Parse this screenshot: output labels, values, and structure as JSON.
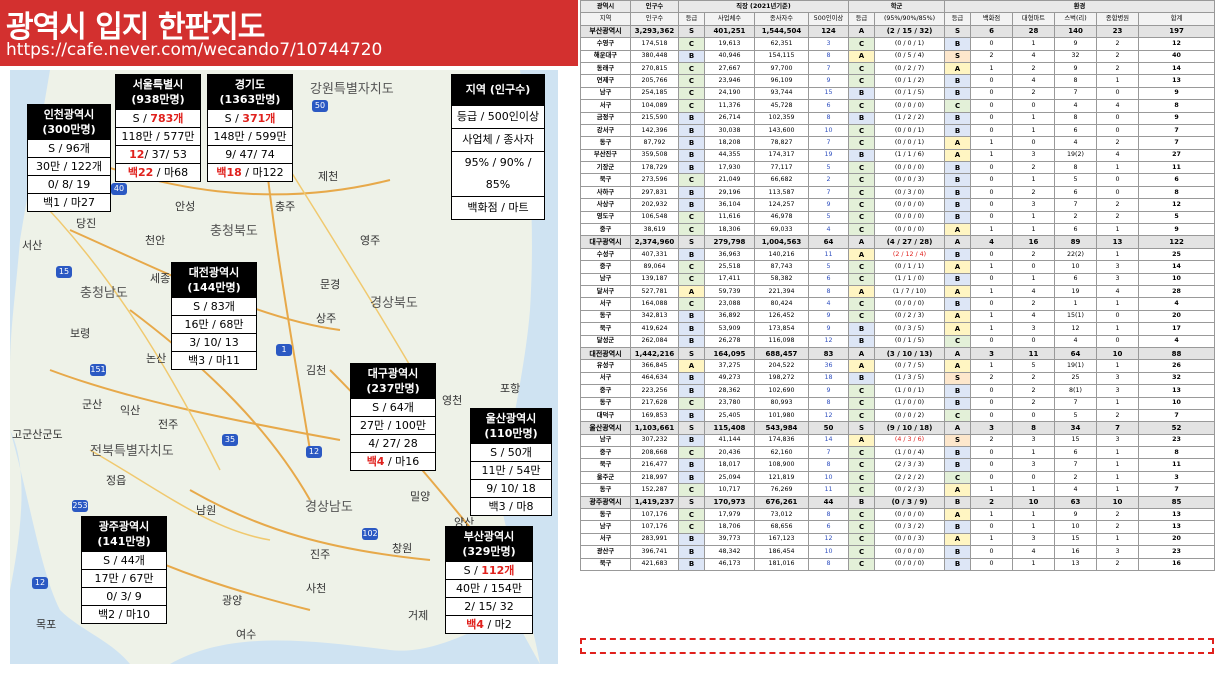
{
  "header": {
    "title": "광역시 입지 한판지도",
    "url": "https://cafe.never.com/wecando7/10744720"
  },
  "colors": {
    "red": "#e0211d",
    "header": "#d3302f"
  },
  "map": {
    "regions": [
      "강원특별자치도",
      "충청북도",
      "충청남도",
      "경상북도",
      "전북특별자치도",
      "경상남도"
    ],
    "places": [
      "안성",
      "충주",
      "제천",
      "당진",
      "서산",
      "천안",
      "영주",
      "세종",
      "문경",
      "보령",
      "논산",
      "상주",
      "김천",
      "군산",
      "익산",
      "전주",
      "영천",
      "포항",
      "정읍",
      "밀양",
      "남원",
      "양산",
      "고군산군도",
      "진주",
      "창원",
      "사천",
      "거제",
      "목포",
      "여수",
      "광양",
      "광주",
      "대구",
      "부산"
    ],
    "highways": [
      "50",
      "15",
      "1",
      "151",
      "35",
      "12",
      "253",
      "102",
      "12",
      "40"
    ]
  },
  "boxes": {
    "incheon": {
      "name": "인천광역시",
      "pop": "(300만명)",
      "r1a": "S / ",
      "r1b": "96개",
      "r2": "30만 / 122개",
      "r3": "0/ 8/ 19",
      "r4": "백1 / 마27"
    },
    "seoul": {
      "name": "서울특별시",
      "pop": "(938만명)",
      "r1a": "S / ",
      "r1b": "783개",
      "r2": "118만 / 577만",
      "r3a": "12",
      "r3b": "/ 37/ 53",
      "r4a": "백22",
      "r4b": " / 마68"
    },
    "gyeonggi": {
      "name": "경기도",
      "pop": "(1363만명)",
      "r1a": "S / ",
      "r1b": "371개",
      "r2": "148만 / 599만",
      "r3": "9/ 47/ 74",
      "r4a": "백18",
      "r4b": " / 마122"
    },
    "legend": {
      "name": "지역  (인구수)",
      "r1": "등급 / 500인이상",
      "r2": "사업체 / 종사자",
      "r3": "95% / 90% / 85%",
      "r4": "백화점 / 마트"
    },
    "daejeon": {
      "name": "대전광역시",
      "pop": "(144만명)",
      "r1": "S / 83개",
      "r2": "16만 / 68만",
      "r3": "3/ 10/ 13",
      "r4": "백3 / 마11"
    },
    "daegu": {
      "name": "대구광역시",
      "pop": "(237만명)",
      "r1": "S / 64개",
      "r2": "27만 / 100만",
      "r3": "4/ 27/ 28",
      "r4a": "백4",
      "r4b": " / 마16"
    },
    "ulsan": {
      "name": "울산광역시",
      "pop": "(110만명)",
      "r1": "S / 50개",
      "r2": "11만 / 54만",
      "r3": "9/ 10/ 18",
      "r4": "백3 / 마8"
    },
    "gwangju": {
      "name": "광주광역시",
      "pop": "(141만명)",
      "r1": "S / 44개",
      "r2": "17만 / 67만",
      "r3": "0/ 3/ 9",
      "r4": "백2 / 마10"
    },
    "busan": {
      "name": "부산광역시",
      "pop": "(329만명)",
      "r1a": "S / ",
      "r1b": "112개",
      "r2": "40만 / 154만",
      "r3": "2/ 15/ 32",
      "r4a": "백4",
      "r4b": " / 마2"
    }
  },
  "table": {
    "h1": {
      "metro": "광역시",
      "pop": "인구수",
      "jobs": "직장 (2021년기준)",
      "school": "학군",
      "env": "환경"
    },
    "h2": [
      "지역",
      "인구수",
      "등급",
      "사업체수",
      "종사자수",
      "500인이상",
      "등급",
      "(95%/90%/85%)",
      "등급",
      "백화점",
      "대형마트",
      "스벅(리)",
      "종합병원",
      "합계"
    ],
    "rows": [
      {
        "m": 1,
        "c": [
          "부산광역시",
          "3,293,362",
          "S",
          "401,251",
          "1,544,504",
          "124",
          "A",
          "(2 / 15 / 32)",
          "S",
          "6",
          "28",
          "140",
          "23",
          "197"
        ]
      },
      {
        "c": [
          "수영구",
          "174,518",
          "C",
          "19,613",
          "62,351",
          "3",
          "C",
          "(0 / 0 / 1)",
          "B",
          "0",
          "1",
          "9",
          "2",
          "12"
        ]
      },
      {
        "c": [
          "해운대구",
          "380,448",
          "B",
          "40,946",
          "154,115",
          "8",
          "A",
          "(0 / 5 / 4)",
          "S",
          "2",
          "4",
          "32",
          "2",
          "40"
        ]
      },
      {
        "c": [
          "동래구",
          "270,815",
          "C",
          "27,667",
          "97,700",
          "7",
          "C",
          "(0 / 2 / 7)",
          "A",
          "1",
          "2",
          "9",
          "2",
          "14"
        ]
      },
      {
        "c": [
          "연제구",
          "205,766",
          "C",
          "23,946",
          "96,109",
          "9",
          "C",
          "(0 / 1 / 2)",
          "B",
          "0",
          "4",
          "8",
          "1",
          "13"
        ]
      },
      {
        "c": [
          "남구",
          "254,185",
          "C",
          "24,190",
          "93,744",
          "15",
          "B",
          "(0 / 1 / 5)",
          "B",
          "0",
          "2",
          "7",
          "0",
          "9"
        ]
      },
      {
        "c": [
          "서구",
          "104,089",
          "C",
          "11,376",
          "45,728",
          "6",
          "C",
          "(0 / 0 / 0)",
          "C",
          "0",
          "0",
          "4",
          "4",
          "8"
        ]
      },
      {
        "c": [
          "금정구",
          "215,590",
          "B",
          "26,714",
          "102,359",
          "8",
          "B",
          "(1 / 2 / 2)",
          "B",
          "0",
          "1",
          "8",
          "0",
          "9"
        ]
      },
      {
        "c": [
          "강서구",
          "142,396",
          "B",
          "30,038",
          "143,600",
          "10",
          "C",
          "(0 / 0 / 1)",
          "B",
          "0",
          "1",
          "6",
          "0",
          "7"
        ]
      },
      {
        "c": [
          "동구",
          "87,792",
          "B",
          "18,208",
          "78,827",
          "7",
          "C",
          "(0 / 0 / 1)",
          "A",
          "1",
          "0",
          "4",
          "2",
          "7"
        ]
      },
      {
        "c": [
          "부산진구",
          "359,508",
          "B",
          "44,355",
          "174,317",
          "19",
          "B",
          "(1 / 1 / 6)",
          "A",
          "1",
          "3",
          "19(2)",
          "4",
          "27"
        ]
      },
      {
        "c": [
          "기장군",
          "178,729",
          "B",
          "17,930",
          "77,117",
          "5",
          "C",
          "(0 / 0 / 0)",
          "B",
          "0",
          "2",
          "8",
          "1",
          "11"
        ]
      },
      {
        "c": [
          "북구",
          "273,596",
          "C",
          "21,049",
          "66,682",
          "2",
          "C",
          "(0 / 0 / 3)",
          "B",
          "0",
          "1",
          "5",
          "0",
          "6"
        ]
      },
      {
        "c": [
          "사하구",
          "297,831",
          "B",
          "29,196",
          "113,587",
          "7",
          "C",
          "(0 / 3 / 0)",
          "B",
          "0",
          "2",
          "6",
          "0",
          "8"
        ]
      },
      {
        "c": [
          "사상구",
          "202,932",
          "B",
          "36,104",
          "124,257",
          "9",
          "C",
          "(0 / 0 / 0)",
          "B",
          "0",
          "3",
          "7",
          "2",
          "12"
        ]
      },
      {
        "c": [
          "영도구",
          "106,548",
          "C",
          "11,616",
          "46,978",
          "5",
          "C",
          "(0 / 0 / 0)",
          "B",
          "0",
          "1",
          "2",
          "2",
          "5"
        ]
      },
      {
        "c": [
          "중구",
          "38,619",
          "C",
          "18,306",
          "69,033",
          "4",
          "C",
          "(0 / 0 / 0)",
          "A",
          "1",
          "1",
          "6",
          "1",
          "9"
        ]
      },
      {
        "m": 1,
        "c": [
          "대구광역시",
          "2,374,960",
          "S",
          "279,798",
          "1,004,563",
          "64",
          "A",
          "(4 / 27 / 28)",
          "A",
          "4",
          "16",
          "89",
          "13",
          "122"
        ]
      },
      {
        "c": [
          "수성구",
          "407,331",
          "B",
          "36,963",
          "140,216",
          "11",
          "A",
          "(2 / 12 / 4)",
          "B",
          "0",
          "2",
          "22(2)",
          "1",
          "25"
        ]
      },
      {
        "c": [
          "중구",
          "89,064",
          "C",
          "25,518",
          "87,743",
          "5",
          "C",
          "(0 / 1 / 1)",
          "A",
          "1",
          "0",
          "10",
          "3",
          "14"
        ]
      },
      {
        "c": [
          "남구",
          "139,187",
          "C",
          "17,411",
          "58,382",
          "6",
          "C",
          "(1 / 1 / 0)",
          "B",
          "0",
          "1",
          "6",
          "3",
          "10"
        ]
      },
      {
        "c": [
          "달서구",
          "527,781",
          "A",
          "59,739",
          "221,394",
          "8",
          "A",
          "(1 / 7 / 10)",
          "A",
          "1",
          "4",
          "19",
          "4",
          "28"
        ]
      },
      {
        "c": [
          "서구",
          "164,088",
          "C",
          "23,088",
          "80,424",
          "4",
          "C",
          "(0 / 0 / 0)",
          "B",
          "0",
          "2",
          "1",
          "1",
          "4"
        ]
      },
      {
        "c": [
          "동구",
          "342,813",
          "B",
          "36,892",
          "126,452",
          "9",
          "C",
          "(0 / 2 / 3)",
          "A",
          "1",
          "4",
          "15(1)",
          "0",
          "20"
        ]
      },
      {
        "c": [
          "북구",
          "419,624",
          "B",
          "53,909",
          "173,854",
          "9",
          "B",
          "(0 / 3 / 5)",
          "A",
          "1",
          "3",
          "12",
          "1",
          "17"
        ]
      },
      {
        "c": [
          "달성군",
          "262,084",
          "B",
          "26,278",
          "116,098",
          "12",
          "B",
          "(0 / 1 / 5)",
          "C",
          "0",
          "0",
          "4",
          "0",
          "4"
        ]
      },
      {
        "m": 1,
        "c": [
          "대전광역시",
          "1,442,216",
          "S",
          "164,095",
          "688,457",
          "83",
          "A",
          "(3 / 10 / 13)",
          "A",
          "3",
          "11",
          "64",
          "10",
          "88"
        ]
      },
      {
        "c": [
          "유성구",
          "366,845",
          "A",
          "37,275",
          "204,522",
          "36",
          "A",
          "(0 / 7 / 5)",
          "A",
          "1",
          "5",
          "19(1)",
          "1",
          "26"
        ]
      },
      {
        "c": [
          "서구",
          "464,634",
          "B",
          "49,273",
          "198,272",
          "18",
          "B",
          "(1 / 3 / 5)",
          "S",
          "2",
          "2",
          "25",
          "3",
          "32"
        ]
      },
      {
        "c": [
          "중구",
          "223,256",
          "B",
          "28,362",
          "102,690",
          "9",
          "C",
          "(1 / 0 / 1)",
          "B",
          "0",
          "2",
          "8(1)",
          "3",
          "13"
        ]
      },
      {
        "c": [
          "동구",
          "217,628",
          "C",
          "23,780",
          "80,993",
          "8",
          "C",
          "(1 / 0 / 0)",
          "B",
          "0",
          "2",
          "7",
          "1",
          "10"
        ]
      },
      {
        "c": [
          "대덕구",
          "169,853",
          "B",
          "25,405",
          "101,980",
          "12",
          "C",
          "(0 / 0 / 2)",
          "C",
          "0",
          "0",
          "5",
          "2",
          "7"
        ]
      },
      {
        "m": 1,
        "c": [
          "울산광역시",
          "1,103,661",
          "S",
          "115,408",
          "543,984",
          "50",
          "S",
          "(9 / 10 / 18)",
          "A",
          "3",
          "8",
          "34",
          "7",
          "52"
        ]
      },
      {
        "c": [
          "남구",
          "307,232",
          "B",
          "41,144",
          "174,836",
          "14",
          "A",
          "(4 / 3 / 6)",
          "S",
          "2",
          "3",
          "15",
          "3",
          "23"
        ]
      },
      {
        "c": [
          "중구",
          "208,668",
          "C",
          "20,436",
          "62,160",
          "7",
          "C",
          "(1 / 0 / 4)",
          "B",
          "0",
          "1",
          "6",
          "1",
          "8"
        ]
      },
      {
        "c": [
          "북구",
          "216,477",
          "B",
          "18,017",
          "108,900",
          "8",
          "C",
          "(2 / 3 / 3)",
          "B",
          "0",
          "3",
          "7",
          "1",
          "11"
        ]
      },
      {
        "c": [
          "울주군",
          "218,997",
          "B",
          "25,094",
          "121,819",
          "10",
          "C",
          "(2 / 2 / 2)",
          "C",
          "0",
          "0",
          "2",
          "1",
          "3"
        ]
      },
      {
        "c": [
          "동구",
          "152,287",
          "C",
          "10,717",
          "76,269",
          "11",
          "C",
          "(0 / 2 / 3)",
          "A",
          "1",
          "1",
          "4",
          "1",
          "7"
        ]
      },
      {
        "m": 1,
        "c": [
          "광주광역시",
          "1,419,237",
          "S",
          "170,973",
          "676,261",
          "44",
          "B",
          "(0 / 3 / 9)",
          "B",
          "2",
          "10",
          "63",
          "10",
          "85"
        ]
      },
      {
        "c": [
          "동구",
          "107,176",
          "C",
          "17,979",
          "73,012",
          "8",
          "C",
          "(0 / 0 / 0)",
          "A",
          "1",
          "1",
          "9",
          "2",
          "13"
        ]
      },
      {
        "c": [
          "남구",
          "107,176",
          "C",
          "18,706",
          "68,656",
          "6",
          "C",
          "(0 / 3 / 2)",
          "B",
          "0",
          "1",
          "10",
          "2",
          "13"
        ]
      },
      {
        "c": [
          "서구",
          "283,991",
          "B",
          "39,773",
          "167,123",
          "12",
          "C",
          "(0 / 0 / 3)",
          "A",
          "1",
          "3",
          "15",
          "1",
          "20"
        ]
      },
      {
        "c": [
          "광산구",
          "396,741",
          "B",
          "48,342",
          "186,454",
          "10",
          "C",
          "(0 / 0 / 0)",
          "B",
          "0",
          "4",
          "16",
          "3",
          "23"
        ]
      },
      {
        "c": [
          "북구",
          "421,683",
          "B",
          "46,173",
          "181,016",
          "8",
          "C",
          "(0 / 0 / 0)",
          "B",
          "0",
          "1",
          "13",
          "2",
          "16"
        ]
      }
    ]
  }
}
